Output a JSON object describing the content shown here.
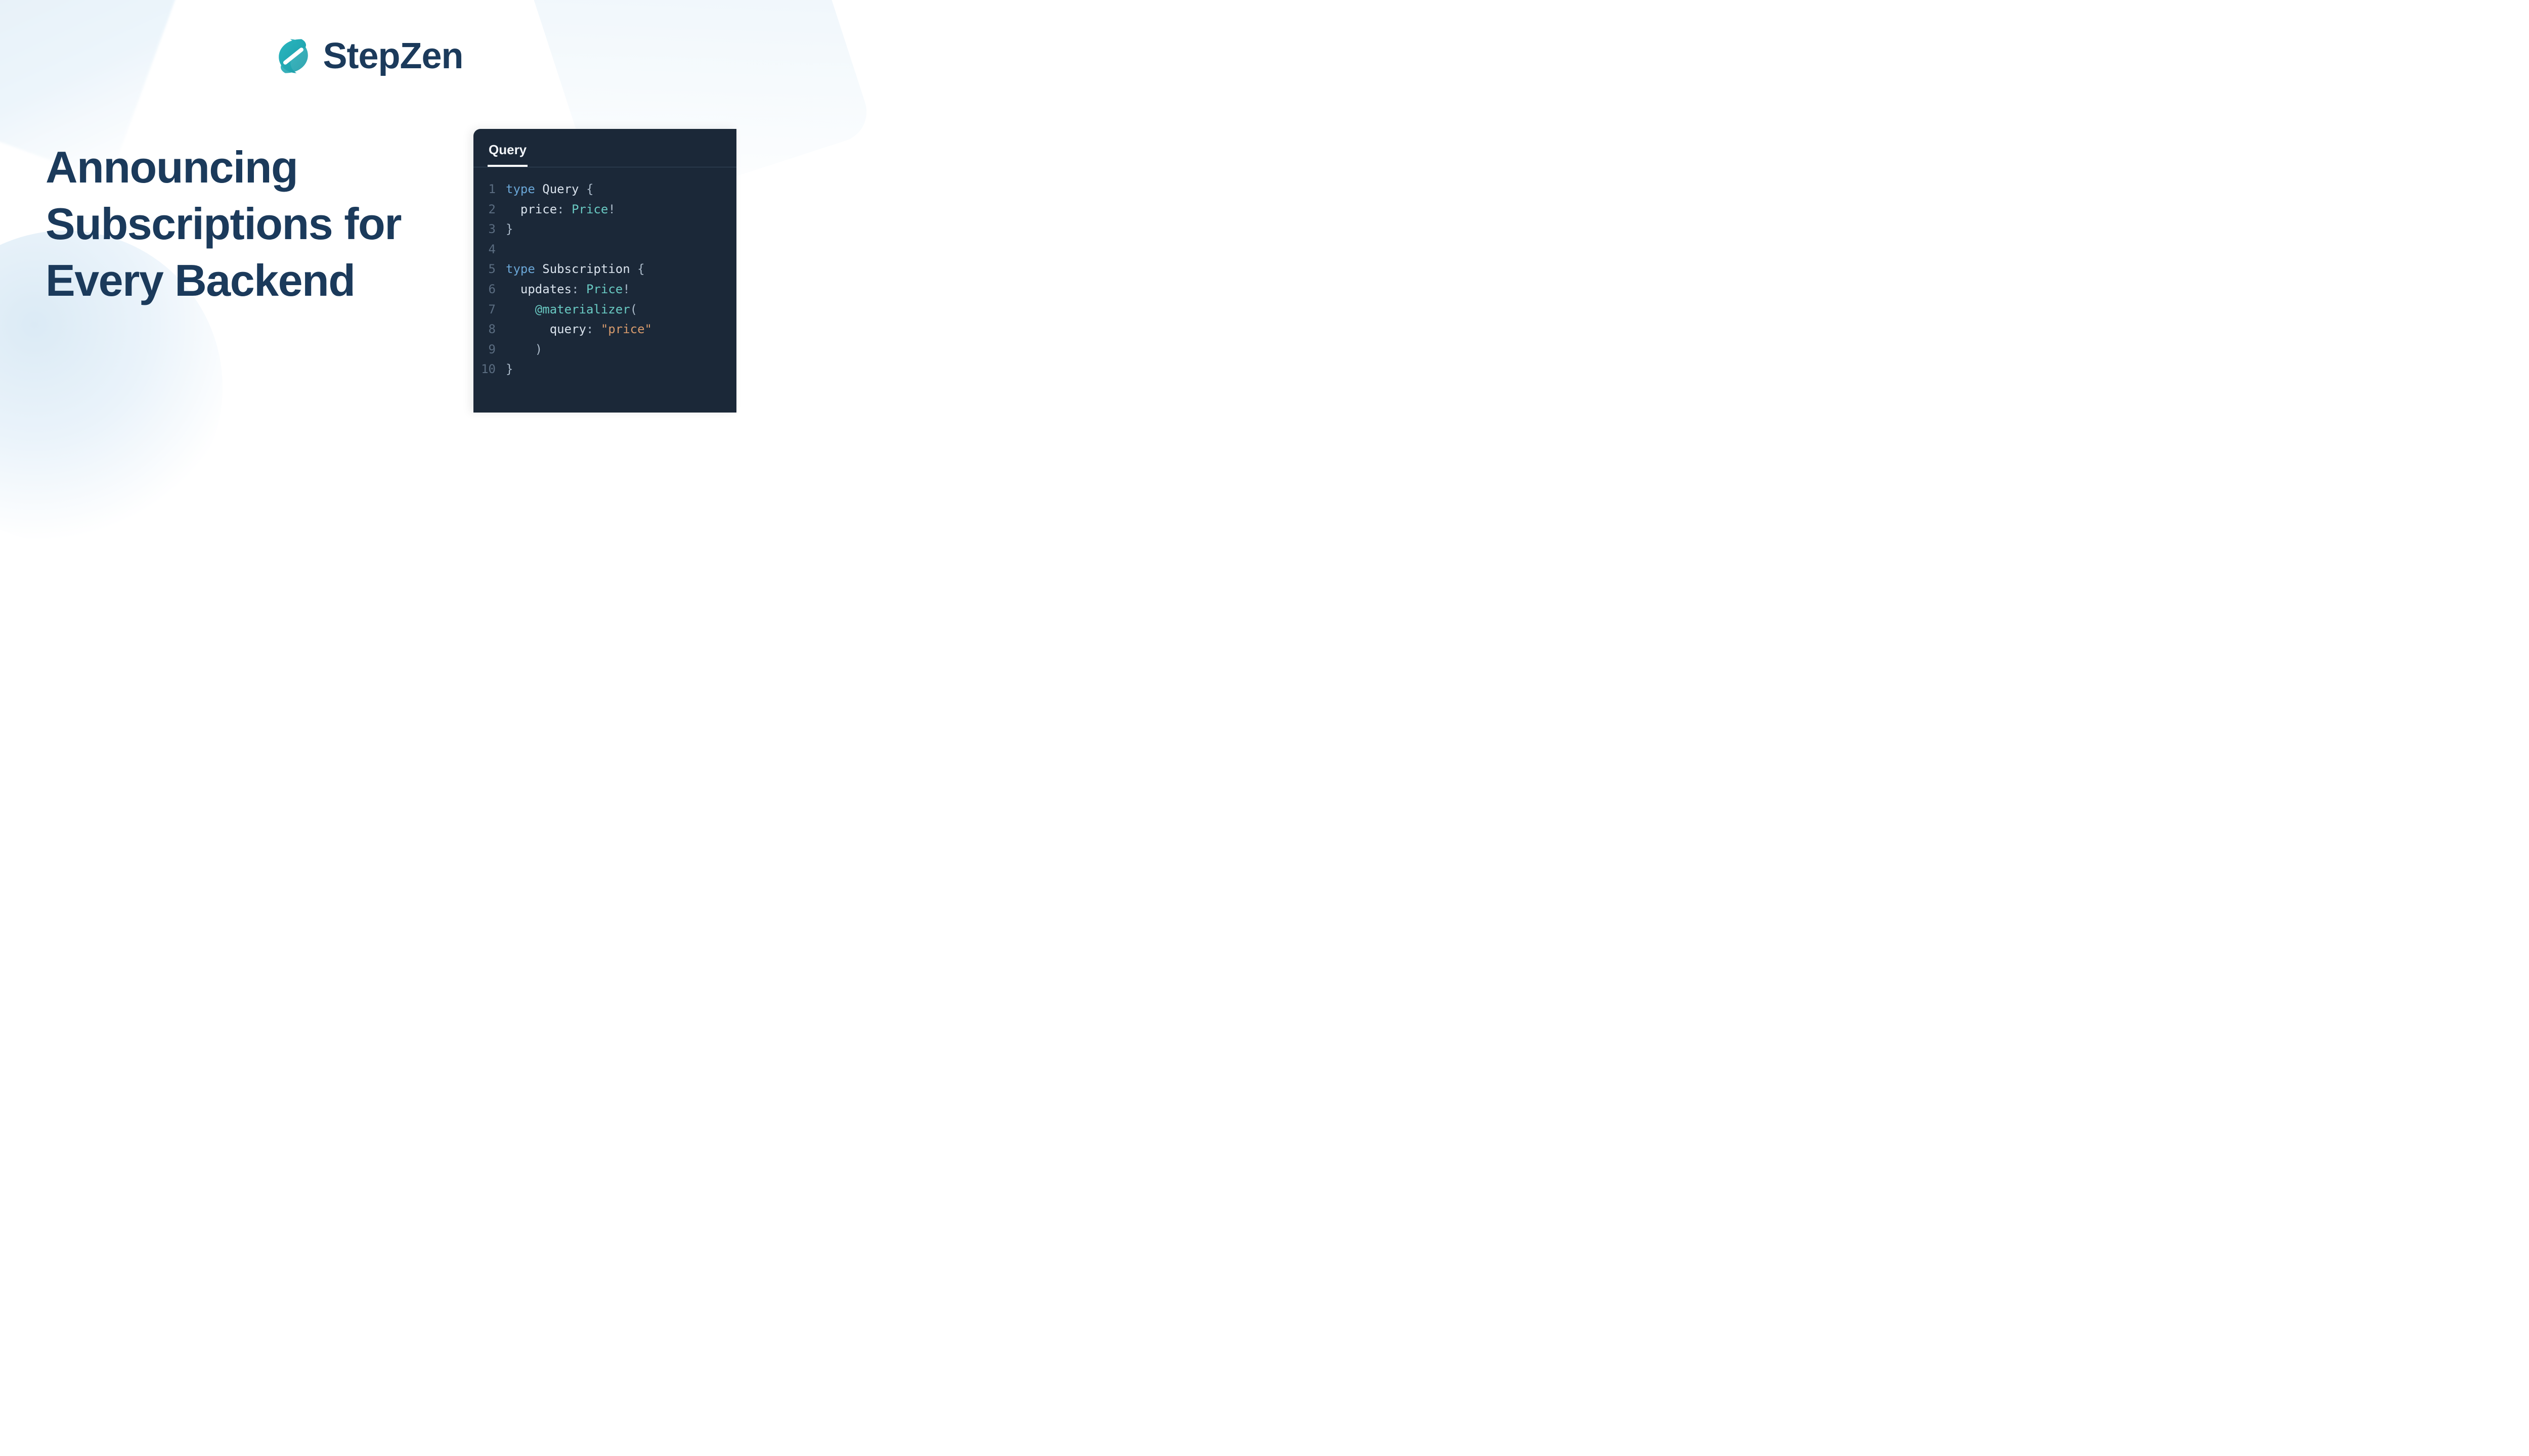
{
  "brand": {
    "name": "StepZen"
  },
  "headline": "Announcing Subscriptions for Every Backend",
  "code_panel": {
    "tab_label": "Query",
    "lines": [
      {
        "n": "1",
        "tokens": [
          {
            "t": "type ",
            "c": "tok-keyword"
          },
          {
            "t": "Query ",
            "c": "tok-typename"
          },
          {
            "t": "{",
            "c": "tok-punct"
          }
        ]
      },
      {
        "n": "2",
        "tokens": [
          {
            "t": "  ",
            "c": ""
          },
          {
            "t": "price",
            "c": "tok-field"
          },
          {
            "t": ": ",
            "c": "tok-punct"
          },
          {
            "t": "Price",
            "c": "tok-type"
          },
          {
            "t": "!",
            "c": "tok-punct"
          }
        ]
      },
      {
        "n": "3",
        "tokens": [
          {
            "t": "}",
            "c": "tok-punct"
          }
        ]
      },
      {
        "n": "4",
        "tokens": [
          {
            "t": " ",
            "c": ""
          }
        ]
      },
      {
        "n": "5",
        "tokens": [
          {
            "t": "type ",
            "c": "tok-keyword"
          },
          {
            "t": "Subscription ",
            "c": "tok-typename"
          },
          {
            "t": "{",
            "c": "tok-punct"
          }
        ]
      },
      {
        "n": "6",
        "tokens": [
          {
            "t": "  ",
            "c": ""
          },
          {
            "t": "updates",
            "c": "tok-field"
          },
          {
            "t": ": ",
            "c": "tok-punct"
          },
          {
            "t": "Price",
            "c": "tok-type"
          },
          {
            "t": "!",
            "c": "tok-punct"
          }
        ]
      },
      {
        "n": "7",
        "tokens": [
          {
            "t": "    ",
            "c": ""
          },
          {
            "t": "@materializer",
            "c": "tok-directive"
          },
          {
            "t": "(",
            "c": "tok-punct"
          }
        ]
      },
      {
        "n": "8",
        "tokens": [
          {
            "t": "      ",
            "c": ""
          },
          {
            "t": "query",
            "c": "tok-arg"
          },
          {
            "t": ": ",
            "c": "tok-punct"
          },
          {
            "t": "\"price\"",
            "c": "tok-string"
          }
        ]
      },
      {
        "n": "9",
        "tokens": [
          {
            "t": "    ",
            "c": ""
          },
          {
            "t": ")",
            "c": "tok-punct"
          }
        ]
      },
      {
        "n": "10",
        "tokens": [
          {
            "t": "}",
            "c": "tok-punct"
          }
        ]
      }
    ]
  },
  "colors": {
    "brand_dark": "#1b3a5b",
    "brand_teal": "#2ab7c0",
    "code_bg": "#1b2838"
  }
}
